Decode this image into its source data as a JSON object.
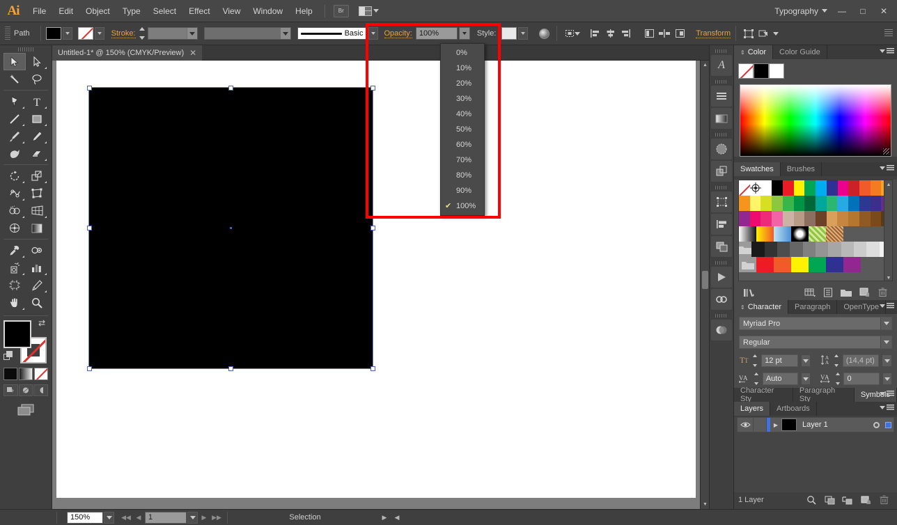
{
  "app": {
    "logo": "Ai",
    "workspace": "Typography",
    "menus": [
      "File",
      "Edit",
      "Object",
      "Type",
      "Select",
      "Effect",
      "View",
      "Window",
      "Help"
    ],
    "bridge_button": "Br",
    "window_buttons": {
      "minimize": "—",
      "maximize": "□",
      "close": "✕"
    }
  },
  "control_bar": {
    "object_label": "Path",
    "stroke_label": "Stroke:",
    "stroke_weight": "",
    "stroke_profile": "",
    "brush_label": "Basic",
    "opacity_label": "Opacity:",
    "opacity_value": "100%",
    "style_label": "Style:",
    "transform_label": "Transform",
    "icons": [
      "fill-swatch",
      "stroke-swatch",
      "stroke-weight-combo",
      "variable-width-combo",
      "brush-definition-combo",
      "opacity-combo",
      "graphic-style-swatch",
      "isolate-blending-icon",
      "align-to-selection-icon",
      "align-left-icon",
      "align-center-icon",
      "align-right-icon",
      "distribute-top-icon",
      "distribute-center-icon",
      "distribute-bottom-icon",
      "envelope-icon",
      "artboard-options-icon"
    ]
  },
  "opacity_menu": {
    "items": [
      "0%",
      "10%",
      "20%",
      "30%",
      "40%",
      "50%",
      "60%",
      "70%",
      "80%",
      "90%",
      "100%"
    ],
    "selected": "100%",
    "check_glyph": "✔"
  },
  "highlight": {
    "color": "#ff0000",
    "target": "opacity-dropdown-region"
  },
  "tools": {
    "rows": [
      [
        {
          "name": "selection-tool",
          "glyph": "selection",
          "active": true,
          "sub": false
        },
        {
          "name": "direct-selection-tool",
          "glyph": "direct-selection",
          "active": false,
          "sub": true
        }
      ],
      [
        {
          "name": "magic-wand-tool",
          "glyph": "magic-wand",
          "active": false,
          "sub": false
        },
        {
          "name": "lasso-tool",
          "glyph": "lasso",
          "active": false,
          "sub": false
        }
      ],
      [
        {
          "name": "pen-tool",
          "glyph": "pen",
          "active": false,
          "sub": true
        },
        {
          "name": "type-tool",
          "glyph": "type",
          "active": false,
          "sub": true
        }
      ],
      [
        {
          "name": "line-segment-tool",
          "glyph": "line",
          "active": false,
          "sub": true
        },
        {
          "name": "rectangle-tool",
          "glyph": "rectangle",
          "active": false,
          "sub": true
        }
      ],
      [
        {
          "name": "paintbrush-tool",
          "glyph": "paintbrush",
          "active": false,
          "sub": true
        },
        {
          "name": "pencil-tool",
          "glyph": "pencil",
          "active": false,
          "sub": true
        }
      ],
      [
        {
          "name": "blob-brush-tool",
          "glyph": "blob-brush",
          "active": false,
          "sub": false
        },
        {
          "name": "eraser-tool",
          "glyph": "eraser",
          "active": false,
          "sub": true
        }
      ],
      [
        {
          "name": "rotate-tool",
          "glyph": "rotate",
          "active": false,
          "sub": true
        },
        {
          "name": "scale-tool",
          "glyph": "scale",
          "active": false,
          "sub": true
        }
      ],
      [
        {
          "name": "width-tool",
          "glyph": "width",
          "active": false,
          "sub": true
        },
        {
          "name": "free-transform-tool",
          "glyph": "free-transform",
          "active": false,
          "sub": false
        }
      ],
      [
        {
          "name": "shape-builder-tool",
          "glyph": "shape-builder",
          "active": false,
          "sub": true
        },
        {
          "name": "perspective-grid-tool",
          "glyph": "perspective-grid",
          "active": false,
          "sub": true
        }
      ],
      [
        {
          "name": "mesh-tool",
          "glyph": "mesh",
          "active": false,
          "sub": false
        },
        {
          "name": "gradient-tool",
          "glyph": "gradient",
          "active": false,
          "sub": false
        }
      ],
      [
        {
          "name": "eyedropper-tool",
          "glyph": "eyedropper",
          "active": false,
          "sub": true
        },
        {
          "name": "blend-tool",
          "glyph": "blend",
          "active": false,
          "sub": false
        }
      ],
      [
        {
          "name": "symbol-sprayer-tool",
          "glyph": "symbol-sprayer",
          "active": false,
          "sub": true
        },
        {
          "name": "column-graph-tool",
          "glyph": "column-graph",
          "active": false,
          "sub": true
        }
      ],
      [
        {
          "name": "artboard-tool",
          "glyph": "artboard",
          "active": false,
          "sub": false
        },
        {
          "name": "slice-tool",
          "glyph": "slice",
          "active": false,
          "sub": true
        }
      ],
      [
        {
          "name": "hand-tool",
          "glyph": "hand",
          "active": false,
          "sub": true
        },
        {
          "name": "zoom-tool",
          "glyph": "zoom",
          "active": false,
          "sub": false
        }
      ]
    ],
    "fill_color": "#000000",
    "stroke_color": "none"
  },
  "document": {
    "tab_title": "Untitled-1* @ 150% (CMYK/Preview)",
    "close_glyph": "✕"
  },
  "status_bar": {
    "zoom": "150%",
    "page": "1",
    "status_text": "Selection",
    "first_glyph": "◀◀",
    "prev_glyph": "◀",
    "next_glyph": "▶",
    "last_glyph": "▶▶"
  },
  "dock_strip": {
    "icons": [
      "character-styles-icon",
      "paragraph-icon",
      "gradient-icon",
      "transparency-icon",
      "pathfinder-icon",
      "transform-icon",
      "align-icon",
      "layers-icon",
      "actions-icon",
      "links-icon",
      "appearance-icon"
    ]
  },
  "panels": {
    "color": {
      "tabs": [
        {
          "label": "Color",
          "active": true
        },
        {
          "label": "Color Guide",
          "active": false
        }
      ],
      "swatches": [
        "none",
        "#000000",
        "#ffffff"
      ]
    },
    "swatches": {
      "tabs": [
        {
          "label": "Swatches",
          "active": true
        },
        {
          "label": "Brushes",
          "active": false
        }
      ],
      "rows": [
        [
          "none",
          "registration",
          "#ffffff",
          "#000000",
          "#ed1c24",
          "#fff200",
          "#00a651",
          "#00aeef",
          "#2e3192",
          "#ec008c",
          "#cc2127",
          "#f15a29",
          "#f47b20",
          "#faa41a"
        ],
        [
          "#f7941e",
          "#fff568",
          "#d7df23",
          "#8dc63f",
          "#39b54a",
          "#009444",
          "#006838",
          "#00a79d",
          "#2bb673",
          "#27aae1",
          "#0072bc",
          "#2b3990",
          "#3b2f8c",
          "#662d91"
        ],
        [
          "#92278f",
          "#ed0c6e",
          "#ee2a7b",
          "#f263a6",
          "#cbb2a5",
          "#b89b87",
          "#8c6f5e",
          "#6b4226",
          "#d9a05b",
          "#c68642",
          "#b5762f",
          "#8f5a23",
          "#7b4a1c",
          "#5b3a1a"
        ],
        [
          "gradient-white-black",
          "gradient-yellow-orange",
          "gradient-blue-white",
          "pattern-dot",
          "pattern-green",
          "pattern-texture"
        ],
        [
          "folder",
          "#1a1a1a",
          "#333333",
          "#4d4d4d",
          "#666666",
          "#808080",
          "#999999",
          "#a6a6a6",
          "#b3b3b3",
          "#cccccc",
          "#e0e0e0",
          "#f2f2f2"
        ],
        [
          "folder",
          "#ed1c24",
          "#f15a29",
          "#fff200",
          "#00a651",
          "#2e3192",
          "#92278f"
        ]
      ],
      "footer_icons": [
        "swatch-libraries-icon",
        "show-swatch-kinds-icon",
        "swatch-options-icon",
        "new-color-group-icon",
        "new-swatch-icon",
        "delete-swatch-icon"
      ]
    },
    "character": {
      "tabs": [
        {
          "label": "Character",
          "active": true
        },
        {
          "label": "Paragraph",
          "active": false
        },
        {
          "label": "OpenType",
          "active": false
        }
      ],
      "font_family": "Myriad Pro",
      "font_style": "Regular",
      "font_size_label": "font-size-icon",
      "font_size": "12 pt",
      "leading_label": "leading-icon",
      "leading": "(14,4 pt)",
      "kerning_label": "kerning-icon",
      "kerning": "Auto",
      "tracking_label": "tracking-icon",
      "tracking": "0"
    },
    "styles": {
      "tabs": [
        {
          "label": "Character Sty",
          "active": false
        },
        {
          "label": "Paragraph Sty",
          "active": false
        },
        {
          "label": "Symbols",
          "active": true
        }
      ]
    },
    "layers": {
      "tabs": [
        {
          "label": "Layers",
          "active": true
        },
        {
          "label": "Artboards",
          "active": false
        }
      ],
      "rows": [
        {
          "name": "Layer 1",
          "visible": true,
          "locked": false,
          "color": "#3f72e0",
          "thumb": "#000000"
        }
      ],
      "footer_count": "1 Layer",
      "footer_icons": [
        "locate-object-icon",
        "make-clipping-mask-icon",
        "create-sublayer-icon",
        "new-layer-icon",
        "delete-layer-icon"
      ]
    }
  },
  "artwork": {
    "shape_fill": "#000000",
    "selection_color": "#4a5fc4"
  }
}
